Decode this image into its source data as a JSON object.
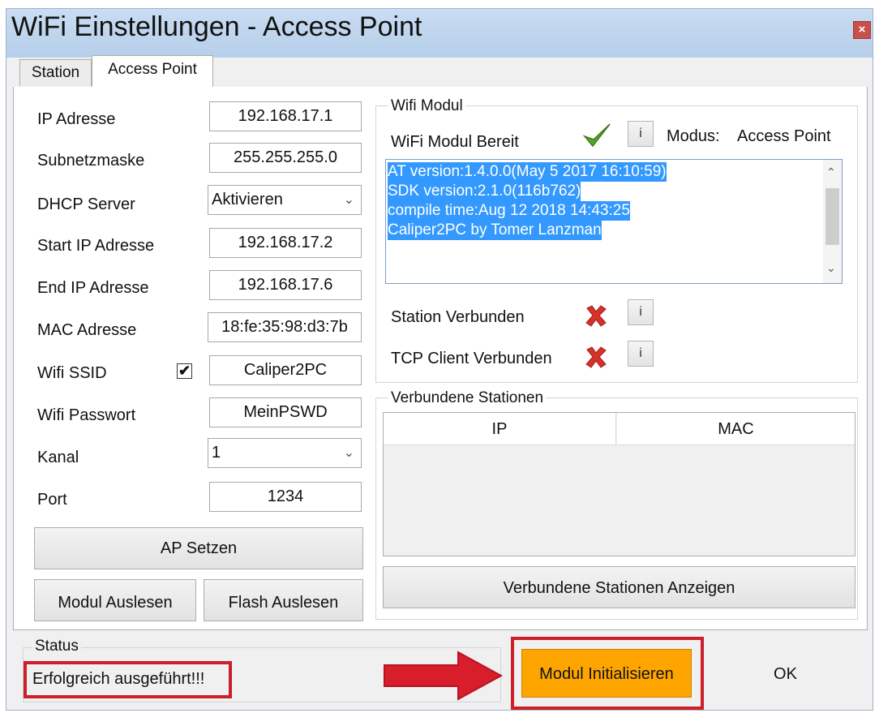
{
  "window": {
    "title": "WiFi Einstellungen - Access Point",
    "close_glyph": "×"
  },
  "tabs": [
    {
      "label": "Station"
    },
    {
      "label": "Access Point"
    }
  ],
  "form": {
    "ip_label": "IP Adresse",
    "ip_value": "192.168.17.1",
    "subnet_label": "Subnetzmaske",
    "subnet_value": "255.255.255.0",
    "dhcp_label": "DHCP Server",
    "dhcp_value": "Aktivieren",
    "start_ip_label": "Start IP Adresse",
    "start_ip_value": "192.168.17.2",
    "end_ip_label": "End IP Adresse",
    "end_ip_value": "192.168.17.6",
    "mac_label": "MAC Adresse",
    "mac_value": "18:fe:35:98:d3:7b",
    "ssid_label": "Wifi SSID",
    "ssid_checked": true,
    "ssid_value": "Caliper2PC",
    "password_label": "Wifi Passwort",
    "password_value": "MeinPSWD",
    "channel_label": "Kanal",
    "channel_value": "1",
    "port_label": "Port",
    "port_value": "1234"
  },
  "buttons": {
    "ap_setzen": "AP Setzen",
    "modul_auslesen": "Modul Auslesen",
    "flash_auslesen": "Flash Auslesen",
    "stationen_anzeigen": "Verbundene Stationen Anzeigen",
    "modul_initialisieren": "Modul Initialisieren",
    "ok": "OK"
  },
  "wifi_modul": {
    "group_label": "Wifi Modul",
    "ready_label": "WiFi Modul Bereit",
    "ready_status": "ok",
    "info_glyph": "i",
    "modus_label": "Modus:",
    "modus_value": "Access Point",
    "log_lines": [
      "AT version:1.4.0.0(May  5 2017 16:10:59)",
      "SDK version:2.1.0(116b762)",
      "compile time:Aug 12 2018 14:43:25",
      "Caliper2PC by Tomer Lanzman"
    ],
    "station_label": "Station Verbunden",
    "tcp_label": "TCP Client Verbunden"
  },
  "stations": {
    "group_label": "Verbundene Stationen",
    "columns": [
      "IP",
      "MAC"
    ]
  },
  "status": {
    "group_label": "Status",
    "text": "Erfolgreich ausgeführt!!!"
  },
  "colors": {
    "highlight_button": "#ffa500",
    "annotation_red": "#cc1f2a",
    "selection_blue": "#3399ff"
  }
}
